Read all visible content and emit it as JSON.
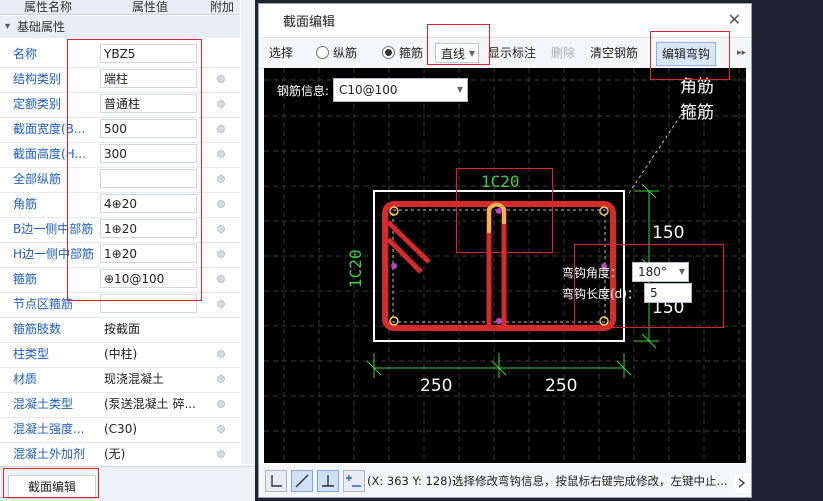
{
  "left_panel": {
    "col_name": "属性名称",
    "col_value": "属性值",
    "col_extra": "附加",
    "group": "基础属性",
    "group_toggle": "▾",
    "rows": [
      {
        "name": "名称",
        "value": "YBZ5"
      },
      {
        "name": "结构类别",
        "value": "端柱"
      },
      {
        "name": "定额类别",
        "value": "普通柱"
      },
      {
        "name": "截面宽度(B...",
        "value": "500"
      },
      {
        "name": "截面高度(H...",
        "value": "300"
      },
      {
        "name": "全部纵筋",
        "value": ""
      },
      {
        "name": "角筋",
        "value": "4⊕20"
      },
      {
        "name": "B边一侧中部筋",
        "value": "1⊕20"
      },
      {
        "name": "H边一侧中部筋",
        "value": "1⊕20"
      },
      {
        "name": "箍筋",
        "value": "⊕10@100"
      },
      {
        "name": "节点区箍筋",
        "value": ""
      },
      {
        "name": "箍筋肢数",
        "value": "按截面"
      },
      {
        "name": "柱类型",
        "value": "(中柱)"
      },
      {
        "name": "材质",
        "value": "现浇混凝土"
      },
      {
        "name": "混凝土类型",
        "value": "(泵送混凝土 碎..."
      },
      {
        "name": "混凝土强度...",
        "value": "(C30)"
      },
      {
        "name": "混凝土外加剂",
        "value": "(无)"
      }
    ],
    "bottom_tab": "截面编辑"
  },
  "dialog": {
    "title": "截面编辑",
    "close_glyph": "✕",
    "toolbar": {
      "select": "选择",
      "longitudinal": "纵筋",
      "stirrup": "箍筋",
      "line_mode": "直线",
      "show_marks": "显示标注",
      "delete": "删除",
      "clear_rebar": "清空钢筋",
      "edit_hook": "编辑弯钩",
      "more": "▸▸"
    },
    "rebar_info_label": "钢筋信息:",
    "rebar_info_value": "C10@100",
    "canvas": {
      "corner_label": "角筋",
      "stirrup_label": "箍筋",
      "top_label": "1C20",
      "left_label": "1C20",
      "dim_right_top": "150",
      "dim_right_bottom": "150",
      "dim_bottom_left": "250",
      "dim_bottom_right": "250",
      "hook_angle_label": "弯钩角度：",
      "hook_angle_value": "180°",
      "hook_length_label": "弯钩长度(d)：",
      "hook_length_value": "5"
    },
    "status_text": "(X: 363 Y: 128)选择修改弯钩信息，按鼠标右键完成修改，左键中止..."
  },
  "colors": {
    "rebar_red": "#d52b2b",
    "dim_green": "#3fd13f",
    "highlight_yellow": "#f0b44c",
    "annotation_red": "#e0232a"
  }
}
